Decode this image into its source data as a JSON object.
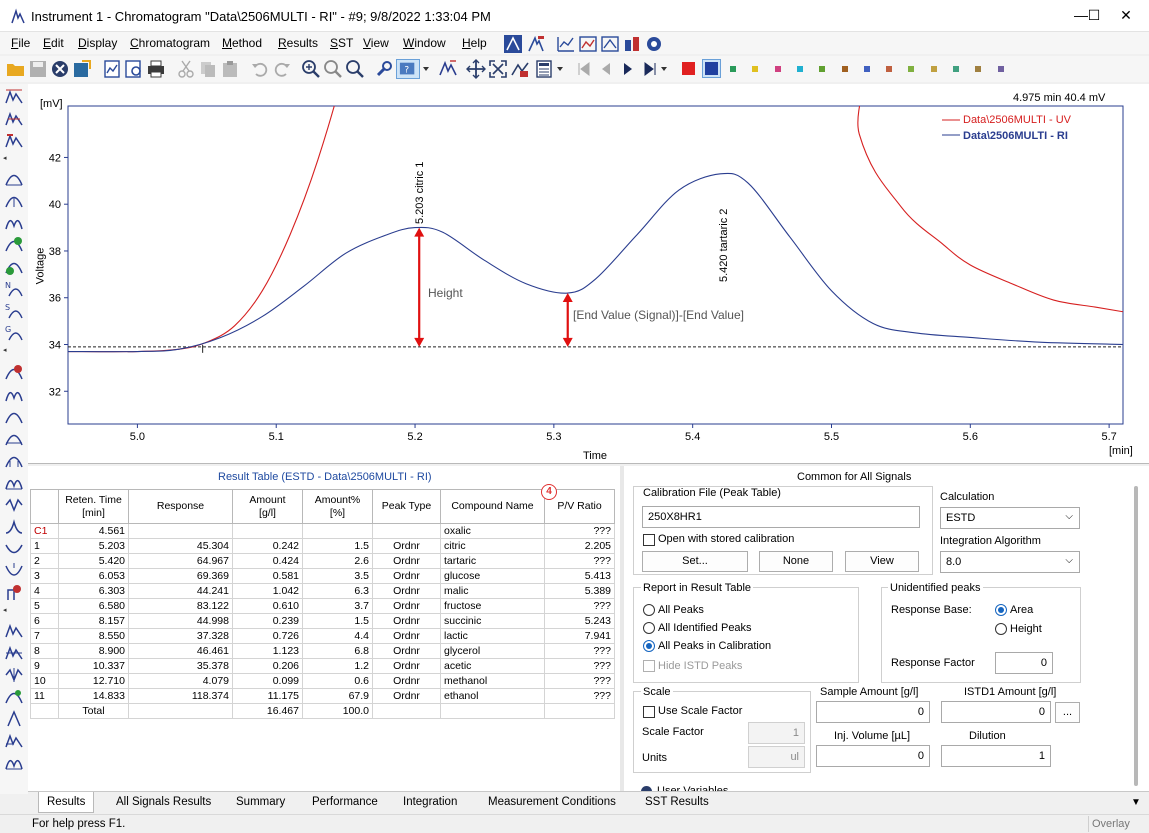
{
  "window": {
    "title": "Instrument 1 - Chromatogram \"Data\\2506MULTI - RI\" - #9;   9/8/2022   1:33:04 PM",
    "minimize": "—",
    "maximize": "☐",
    "close": "✕"
  },
  "menu": [
    {
      "label": "File",
      "u": "F",
      "rest": "ile"
    },
    {
      "label": "Edit",
      "u": "E",
      "rest": "dit"
    },
    {
      "label": "Display",
      "u": "D",
      "rest": "isplay"
    },
    {
      "label": "Chromatogram",
      "u": "C",
      "rest": "hromatogram"
    },
    {
      "label": "Method",
      "u": "M",
      "rest": "ethod"
    },
    {
      "label": "Results",
      "u": "R",
      "rest": "esults"
    },
    {
      "label": "SST",
      "u": "S",
      "rest": "ST"
    },
    {
      "label": "View",
      "u": "V",
      "rest": "iew"
    },
    {
      "label": "Window",
      "u": "W",
      "rest": "indow"
    },
    {
      "label": "Help",
      "u": "H",
      "rest": "elp"
    }
  ],
  "toolbar_colors": [
    "#e02020",
    "#2040a0",
    "#2a9a5a",
    "#e0c020",
    "#d04080",
    "#20b0d0",
    "#60a030",
    "#a06020",
    "#4060c0",
    "#c06040",
    "#80b040",
    "#c0a040",
    "#40a080",
    "#a08040",
    "#7060a0"
  ],
  "chart": {
    "readout": "4.975 min   40.4 mV",
    "y_unit": "[mV]",
    "y_label": "Voltage",
    "x_label": "Time",
    "x_unit": "[min]",
    "annot_height": "Height",
    "annot_end": "[End Value (Signal)]-[End Value]",
    "peak1": "5.203 citric   1",
    "peak2": "5.420 tartaric   2"
  },
  "chart_data": {
    "type": "line",
    "xlim": [
      4.95,
      5.71
    ],
    "ylim": [
      30.6,
      44.2
    ],
    "x_ticks": [
      "5.0",
      "5.1",
      "5.2",
      "5.3",
      "5.4",
      "5.5",
      "5.6",
      "5.7"
    ],
    "x_tick_values": [
      5.0,
      5.1,
      5.2,
      5.3,
      5.4,
      5.5,
      5.6,
      5.7
    ],
    "y_ticks": [
      "32",
      "34",
      "36",
      "38",
      "40",
      "42"
    ],
    "y_tick_values": [
      32,
      34,
      36,
      38,
      40,
      42
    ],
    "baseline_y": 33.9,
    "series": [
      {
        "name": "Data\\2506MULTI - UV",
        "color": "#d62020",
        "x": [
          4.95,
          5.0,
          5.03,
          5.05,
          5.07,
          5.09,
          5.11,
          5.13,
          5.15,
          5.165,
          5.5,
          5.52,
          5.55,
          5.58,
          5.6,
          5.63,
          5.66,
          5.69,
          5.71
        ],
        "y": [
          33.7,
          33.7,
          33.8,
          34.1,
          34.8,
          36.3,
          38.7,
          41.9,
          46.0,
          50.0,
          50.0,
          43.0,
          39.9,
          38.3,
          37.4,
          36.6,
          35.9,
          35.6,
          35.4
        ]
      },
      {
        "name": "Data\\2506MULTI - RI",
        "color": "#2a3d8f",
        "x": [
          4.95,
          5.0,
          5.03,
          5.06,
          5.09,
          5.12,
          5.15,
          5.18,
          5.2,
          5.22,
          5.25,
          5.28,
          5.31,
          5.33,
          5.36,
          5.39,
          5.42,
          5.44,
          5.47,
          5.5,
          5.53,
          5.56,
          5.6,
          5.65,
          5.71
        ],
        "y": [
          33.7,
          33.7,
          33.8,
          34.3,
          35.2,
          36.5,
          37.9,
          38.7,
          39.0,
          38.8,
          37.6,
          36.6,
          36.2,
          36.8,
          38.7,
          40.6,
          41.3,
          40.9,
          38.6,
          36.3,
          34.9,
          34.5,
          34.3,
          34.1,
          34.0
        ]
      }
    ]
  },
  "result_table": {
    "title": "Result Table (ESTD - Data\\2506MULTI - RI)",
    "badge": "4",
    "headers": [
      "",
      "Reten. Time\n[min]",
      "Response",
      "Amount\n[g/l]",
      "Amount%\n[%]",
      "Peak Type",
      "Compound Name",
      "P/V Ratio"
    ],
    "rows": [
      [
        "C1",
        "4.561",
        "",
        "",
        "",
        "",
        "oxalic",
        "???"
      ],
      [
        "1",
        "5.203",
        "45.304",
        "0.242",
        "1.5",
        "Ordnr",
        "citric",
        "2.205"
      ],
      [
        "2",
        "5.420",
        "64.967",
        "0.424",
        "2.6",
        "Ordnr",
        "tartaric",
        "???"
      ],
      [
        "3",
        "6.053",
        "69.369",
        "0.581",
        "3.5",
        "Ordnr",
        "glucose",
        "5.413"
      ],
      [
        "4",
        "6.303",
        "44.241",
        "1.042",
        "6.3",
        "Ordnr",
        "malic",
        "5.389"
      ],
      [
        "5",
        "6.580",
        "83.122",
        "0.610",
        "3.7",
        "Ordnr",
        "fructose",
        "???"
      ],
      [
        "6",
        "8.157",
        "44.998",
        "0.239",
        "1.5",
        "Ordnr",
        "succinic",
        "5.243"
      ],
      [
        "7",
        "8.550",
        "37.328",
        "0.726",
        "4.4",
        "Ordnr",
        "lactic",
        "7.941"
      ],
      [
        "8",
        "8.900",
        "46.461",
        "1.123",
        "6.8",
        "Ordnr",
        "glycerol",
        "???"
      ],
      [
        "9",
        "10.337",
        "35.378",
        "0.206",
        "1.2",
        "Ordnr",
        "acetic",
        "???"
      ],
      [
        "10",
        "12.710",
        "4.079",
        "0.099",
        "0.6",
        "Ordnr",
        "methanol",
        "???"
      ],
      [
        "11",
        "14.833",
        "118.374",
        "11.175",
        "67.9",
        "Ordnr",
        "ethanol",
        "???"
      ]
    ],
    "total": [
      "",
      "Total",
      "",
      "16.467",
      "100.0",
      "",
      "",
      ""
    ]
  },
  "right_panel": {
    "title": "Common for All Signals",
    "cal_file_label": "Calibration File (Peak Table)",
    "cal_file_value": "250X8HR1",
    "open_stored": "Open with stored calibration",
    "btn_set": "Set...",
    "btn_none": "None",
    "btn_view": "View",
    "calculation_label": "Calculation",
    "calculation_value": "ESTD",
    "integ_label": "Integration Algorithm",
    "integ_value": "8.0",
    "report_label": "Report in Result Table",
    "all_peaks": "All Peaks",
    "all_identified": "All Identified Peaks",
    "all_in_cal": "All Peaks in Calibration",
    "hide_istd": "Hide ISTD Peaks",
    "unident_label": "Unidentified peaks",
    "resp_base": "Response Base:",
    "area": "Area",
    "height": "Height",
    "resp_factor": "Response Factor",
    "resp_factor_value": "0",
    "scale_label": "Scale",
    "use_scale": "Use Scale Factor",
    "scale_factor": "Scale Factor",
    "scale_factor_value": "1",
    "units": "Units",
    "units_value": "ul",
    "sample_amount": "Sample Amount [g/l]",
    "sample_amount_value": "0",
    "istd_amount": "ISTD1 Amount [g/l]",
    "istd_amount_value": "0",
    "istd_more": "...",
    "inj_volume": "Inj. Volume [µL]",
    "inj_volume_value": "0",
    "dilution": "Dilution",
    "dilution_value": "1",
    "user_variables": "User Variables"
  },
  "tabs": [
    "Results",
    "All Signals Results",
    "Summary",
    "Performance",
    "Integration",
    "Measurement Conditions",
    "SST Results"
  ],
  "status": {
    "help": "For help press F1.",
    "overlay": "Overlay"
  }
}
